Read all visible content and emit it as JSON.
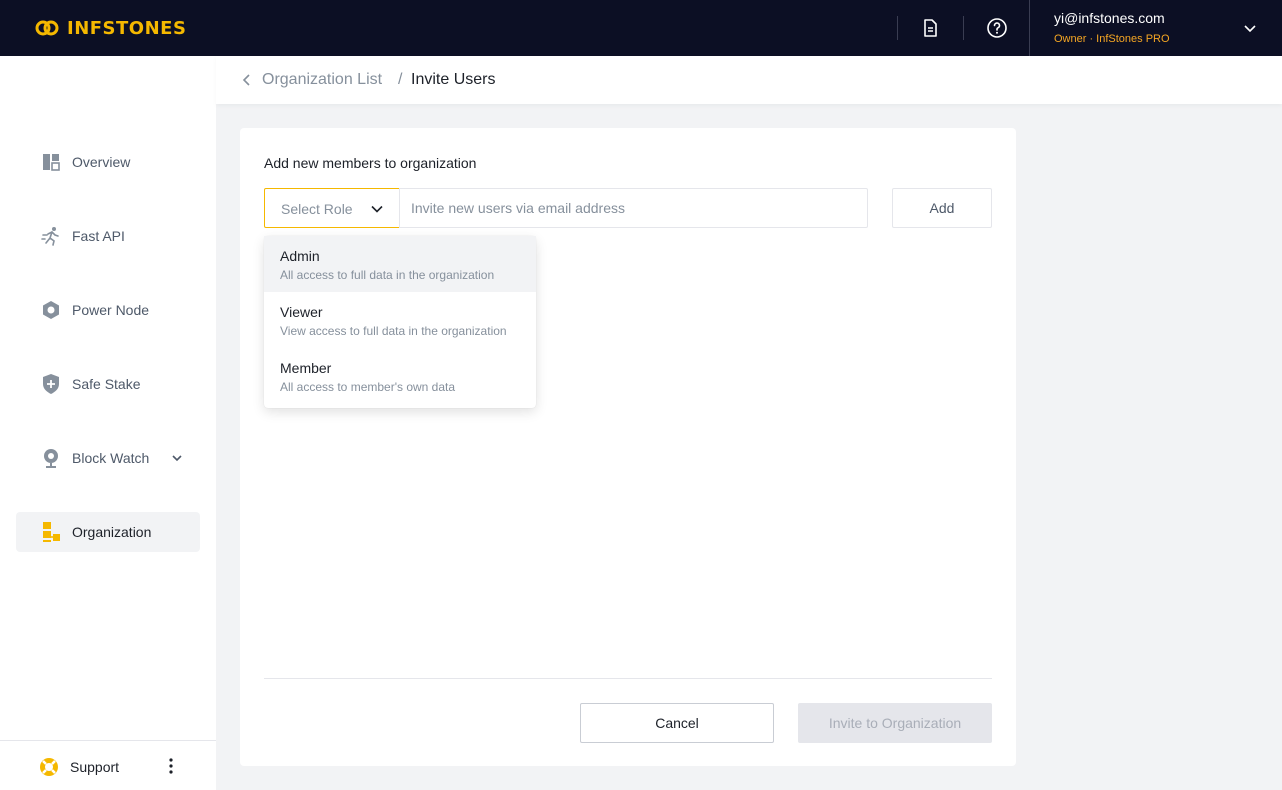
{
  "brand": {
    "name": "INFSTONES",
    "accent": "#f5b800"
  },
  "topbar": {
    "icons": [
      "document-icon",
      "help-icon"
    ],
    "account": {
      "email": "yi@infstones.com",
      "role": "Owner · InfStones PRO"
    }
  },
  "sidebar": {
    "items": [
      {
        "label": "Overview",
        "icon": "overview-icon"
      },
      {
        "label": "Fast API",
        "icon": "fast-api-icon"
      },
      {
        "label": "Power Node",
        "icon": "power-node-icon"
      },
      {
        "label": "Safe Stake",
        "icon": "shield-icon"
      },
      {
        "label": "Block Watch",
        "icon": "block-watch-icon"
      },
      {
        "label": "Organization",
        "icon": "organization-icon"
      }
    ],
    "active": "Organization",
    "support_label": "Support"
  },
  "breadcrumb": {
    "parent": "Organization List",
    "separator": "/",
    "current": "Invite Users"
  },
  "form": {
    "title": "Add new members to organization",
    "role_placeholder": "Select Role",
    "email_placeholder": "Invite new users via email address",
    "add_label": "Add",
    "cancel_label": "Cancel",
    "invite_label": "Invite to Organization"
  },
  "roles": [
    {
      "name": "Admin",
      "description": "All access to full data in the organization"
    },
    {
      "name": "Viewer",
      "description": "View access to full data in the organization"
    },
    {
      "name": "Member",
      "description": "All access to member's own data"
    }
  ]
}
